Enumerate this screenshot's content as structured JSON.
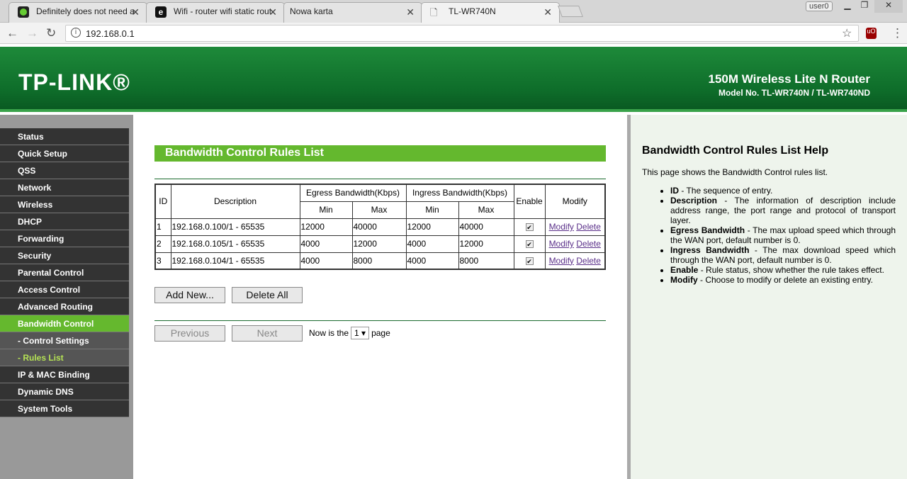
{
  "browser": {
    "tabs": [
      {
        "title": "Definitely does not need a",
        "icon": "green-circle-icon"
      },
      {
        "title": "Wifi - router wifi static rout",
        "icon": "e-icon"
      },
      {
        "title": "Nowa karta",
        "icon": ""
      },
      {
        "title": "TL-WR740N",
        "icon": "page-icon",
        "active": true
      }
    ],
    "user": "user0",
    "url": "192.168.0.1"
  },
  "header": {
    "logo": "TP-LINK®",
    "product": "150M Wireless Lite N Router",
    "model": "Model No. TL-WR740N / TL-WR740ND"
  },
  "sidebar": {
    "items": [
      {
        "label": "Status"
      },
      {
        "label": "Quick Setup"
      },
      {
        "label": "QSS"
      },
      {
        "label": "Network"
      },
      {
        "label": "Wireless"
      },
      {
        "label": "DHCP"
      },
      {
        "label": "Forwarding"
      },
      {
        "label": "Security"
      },
      {
        "label": "Parental Control"
      },
      {
        "label": "Access Control"
      },
      {
        "label": "Advanced Routing"
      },
      {
        "label": "Bandwidth Control",
        "state": "selected"
      },
      {
        "label": "- Control Settings",
        "state": "sub"
      },
      {
        "label": "- Rules List",
        "state": "subselected"
      },
      {
        "label": "IP & MAC Binding"
      },
      {
        "label": "Dynamic DNS"
      },
      {
        "label": "System Tools"
      }
    ]
  },
  "main": {
    "title": "Bandwidth Control Rules List",
    "headers": {
      "id": "ID",
      "description": "Description",
      "egress": "Egress Bandwidth(Kbps)",
      "ingress": "Ingress Bandwidth(Kbps)",
      "min": "Min",
      "max": "Max",
      "enable": "Enable",
      "modify": "Modify"
    },
    "rows": [
      {
        "id": "1",
        "description": "192.168.0.100/1 - 65535",
        "egress_min": "12000",
        "egress_max": "40000",
        "ingress_min": "12000",
        "ingress_max": "40000",
        "enabled": true
      },
      {
        "id": "2",
        "description": "192.168.0.105/1 - 65535",
        "egress_min": "4000",
        "egress_max": "12000",
        "ingress_min": "4000",
        "ingress_max": "12000",
        "enabled": true
      },
      {
        "id": "3",
        "description": "192.168.0.104/1 - 65535",
        "egress_min": "4000",
        "egress_max": "8000",
        "ingress_min": "4000",
        "ingress_max": "8000",
        "enabled": true
      }
    ],
    "modify_link": "Modify",
    "delete_link": "Delete",
    "add_new": "Add New...",
    "delete_all": "Delete All",
    "previous": "Previous",
    "next": "Next",
    "now_is_the": "Now is the",
    "page_value": "1 ▾",
    "page": "page"
  },
  "help": {
    "title": "Bandwidth Control Rules List Help",
    "intro": "This page shows the Bandwidth Control rules list.",
    "items": [
      {
        "term": "ID",
        "text": " - The sequence of entry."
      },
      {
        "term": "Description",
        "text": " - The information of description include address range, the port range and protocol of transport layer."
      },
      {
        "term": "Egress Bandwidth",
        "text": " - The max upload speed which through the WAN port, default number is 0."
      },
      {
        "term": "Ingress Bandwidth",
        "text": " - The max download speed which through the WAN port, default number is 0."
      },
      {
        "term": "Enable",
        "text": " - Rule status, show whether the rule takes effect."
      },
      {
        "term": "Modify",
        "text": " - Choose to modify or delete an existing entry."
      }
    ]
  }
}
